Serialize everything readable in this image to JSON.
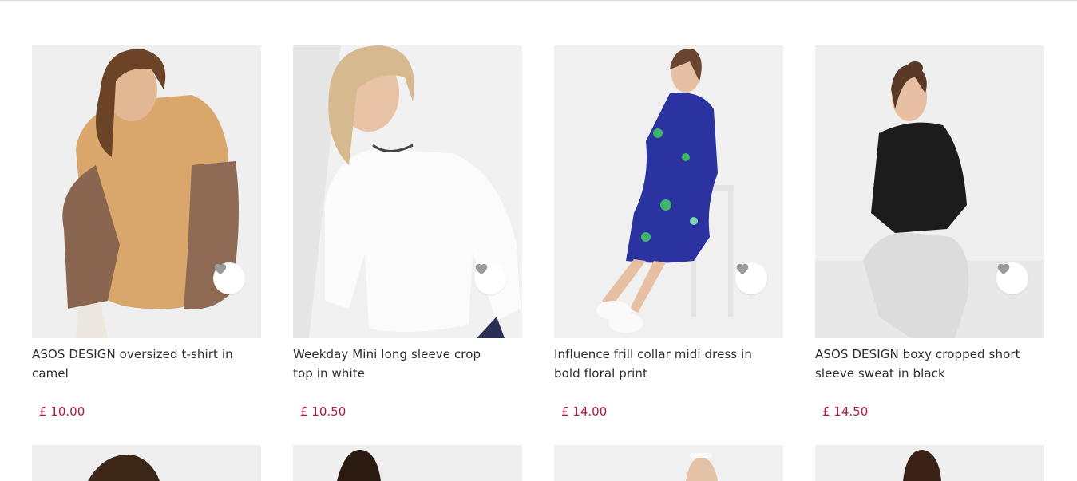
{
  "products": [
    {
      "title": "ASOS DESIGN oversized t-shirt in camel",
      "price": "£ 10.00",
      "image": "model-camel-tshirt"
    },
    {
      "title": "Weekday Mini long sleeve crop top in white",
      "price": "£ 10.50",
      "image": "model-white-crop-top"
    },
    {
      "title": "Influence frill collar midi dress in bold floral print",
      "price": "£ 14.00",
      "image": "model-floral-midi-dress"
    },
    {
      "title": "ASOS DESIGN boxy cropped short sleeve sweat in black",
      "price": "£ 14.50",
      "image": "model-black-sweat"
    }
  ],
  "wishlist_icon": "heart-icon",
  "colors": {
    "price": "#b5173a",
    "wishlist_heart": "#9b9b9b"
  }
}
